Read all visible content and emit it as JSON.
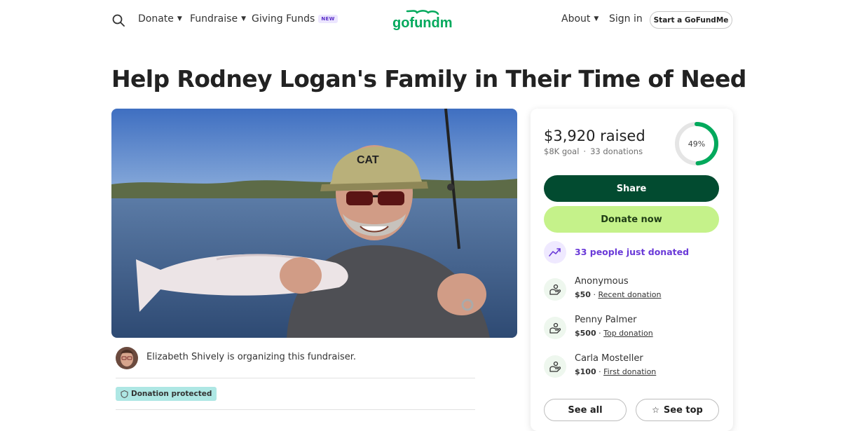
{
  "nav": {
    "search_icon": "search-icon",
    "donate_label": "Donate",
    "fundraise_label": "Fundraise",
    "giving_funds_label": "Giving Funds",
    "giving_funds_badge": "NEW",
    "about_label": "About",
    "signin_label": "Sign in",
    "start_label": "Start a GoFundMe",
    "logo_text": "gofundme"
  },
  "campaign": {
    "title": "Help Rodney Logan's Family in Their Time of Need",
    "organizer_text": "Elizabeth Shively is organizing this fundraiser.",
    "protected_label": "Donation protected"
  },
  "donation": {
    "raised_text": "$3,920 raised",
    "goal_text": "$8K goal",
    "count_text": "33 donations",
    "progress_percent": 49,
    "progress_label": "49%",
    "share_label": "Share",
    "donate_label": "Donate now",
    "trending_text": "33 people just donated",
    "donors": [
      {
        "name": "Anonymous",
        "amount": "$50",
        "tag": "Recent donation"
      },
      {
        "name": "Penny Palmer",
        "amount": "$500",
        "tag": "Top donation"
      },
      {
        "name": "Carla Mosteller",
        "amount": "$100",
        "tag": "First donation"
      }
    ],
    "see_all_label": "See all",
    "see_top_label": "See top"
  },
  "colors": {
    "brand_green": "#02a95c",
    "share_button": "#024b30",
    "donate_button": "#c5f28a",
    "trending_purple": "#6a3ad8",
    "protected_badge": "#aee7e4"
  }
}
